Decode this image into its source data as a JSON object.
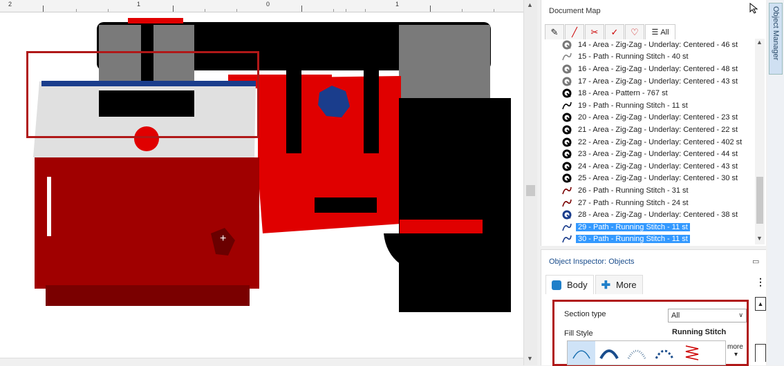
{
  "ruler": {
    "labels": [
      "2",
      "1",
      "0",
      "1"
    ]
  },
  "document_map": {
    "title": "Document Map",
    "tabs": [
      {
        "icon": "pencil-icon"
      },
      {
        "icon": "brush-icon"
      },
      {
        "icon": "scissors-icon"
      },
      {
        "icon": "needle-icon"
      },
      {
        "icon": "heart-outline-icon"
      },
      {
        "icon": "list-icon",
        "label": "All"
      }
    ],
    "items": [
      {
        "label": "14 - Area - Zig-Zag - Underlay: Centered - 46 st",
        "icon": "area-outline-icon",
        "color": "#777777",
        "selected": false
      },
      {
        "label": "15 - Path - Running Stitch - 40 st",
        "icon": "path-icon",
        "color": "#888888",
        "selected": false
      },
      {
        "label": "16 - Area - Zig-Zag - Underlay: Centered - 48 st",
        "icon": "area-outline-icon",
        "color": "#777777",
        "selected": false
      },
      {
        "label": "17 - Area - Zig-Zag - Underlay: Centered - 43 st",
        "icon": "area-outline-icon",
        "color": "#777777",
        "selected": false
      },
      {
        "label": "18 - Area - Pattern - 767 st",
        "icon": "area-solid-icon",
        "color": "#000000",
        "selected": false
      },
      {
        "label": "19 - Path - Running Stitch - 11 st",
        "icon": "path-icon",
        "color": "#000000",
        "selected": false
      },
      {
        "label": "20 - Area - Zig-Zag - Underlay: Centered - 23 st",
        "icon": "area-solid-icon",
        "color": "#000000",
        "selected": false
      },
      {
        "label": "21 - Area - Zig-Zag - Underlay: Centered - 22 st",
        "icon": "area-solid-icon",
        "color": "#000000",
        "selected": false
      },
      {
        "label": "22 - Area - Zig-Zag - Underlay: Centered - 402 st",
        "icon": "area-solid-icon",
        "color": "#000000",
        "selected": false
      },
      {
        "label": "23 - Area - Zig-Zag - Underlay: Centered - 44 st",
        "icon": "area-solid-icon",
        "color": "#000000",
        "selected": false
      },
      {
        "label": "24 - Area - Zig-Zag - Underlay: Centered - 43 st",
        "icon": "area-solid-icon",
        "color": "#000000",
        "selected": false
      },
      {
        "label": "25 - Area - Zig-Zag - Underlay: Centered - 30 st",
        "icon": "area-solid-icon",
        "color": "#000000",
        "selected": false
      },
      {
        "label": "26 - Path - Running Stitch - 31 st",
        "icon": "path-icon",
        "color": "#7a0000",
        "selected": false
      },
      {
        "label": "27 - Path - Running Stitch - 24 st",
        "icon": "path-icon",
        "color": "#7a0000",
        "selected": false
      },
      {
        "label": "28 - Area - Zig-Zag - Underlay: Centered - 38 st",
        "icon": "area-solid-icon",
        "color": "#1a3d8c",
        "selected": false
      },
      {
        "label": "29 - Path - Running Stitch - 11 st",
        "icon": "path-icon",
        "color": "#1a3d8c",
        "selected": true
      },
      {
        "label": "30 - Path - Running Stitch - 11 st",
        "icon": "path-icon",
        "color": "#1a3d8c",
        "selected": true
      }
    ]
  },
  "object_inspector": {
    "title": "Object Inspector: Objects",
    "tabs": [
      {
        "label": "Body",
        "icon": "body-icon",
        "active": true
      },
      {
        "label": "More",
        "icon": "plus-icon",
        "active": false
      }
    ],
    "section_type_label": "Section type",
    "section_type_value": "All",
    "fill_style_label": "Fill Style",
    "fill_style_value": "Running Stitch",
    "more_label": "more"
  },
  "side_tab": {
    "label": "Object Manager"
  },
  "colors": {
    "selection": "#3399ff",
    "highlight_box": "#b01818",
    "red_fill": "#e00000",
    "dark_red": "#a00000",
    "gray": "#7a7a7a",
    "blue_stitch": "#1a3d8c"
  }
}
